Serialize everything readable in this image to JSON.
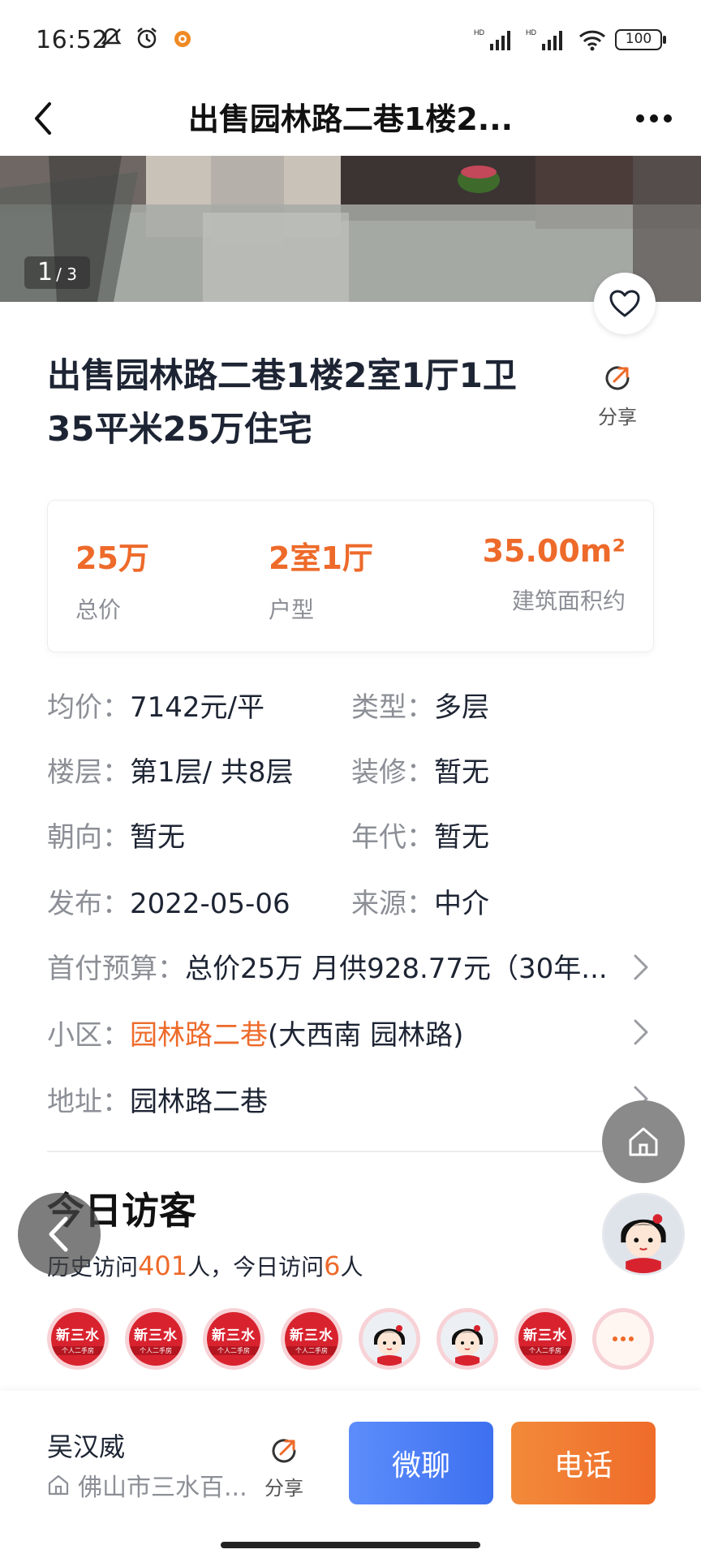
{
  "status_bar": {
    "time": "16:52",
    "battery": "100",
    "icons": [
      "mute-icon",
      "alarm-icon",
      "notification-icon",
      "signal-icon",
      "wifi-icon",
      "battery-icon"
    ]
  },
  "nav": {
    "title": "出售园林路二巷1楼2..."
  },
  "photo": {
    "current": "1",
    "total": " / 3"
  },
  "listing": {
    "title_line1": "出售园林路二巷1楼2室1厅1卫",
    "title_line2": "35平米25万住宅",
    "share_label": "分享"
  },
  "summary": {
    "price_value": "25万",
    "price_label": "总价",
    "layout_value": "2室1厅",
    "layout_label": "户型",
    "area_value": "35.00m²",
    "area_label": "建筑面积约"
  },
  "details": {
    "unit_price_label": "均价：",
    "unit_price_value": "7142元/平",
    "type_label": "类型：",
    "type_value": "多层",
    "floor_label": "楼层：",
    "floor_value": "第1层/ 共8层",
    "decor_label": "装修：",
    "decor_value": "暂无",
    "orient_label": "朝向：",
    "orient_value": "暂无",
    "year_label": "年代：",
    "year_value": "暂无",
    "publish_label": "发布：",
    "publish_value": "2022-05-06",
    "source_label": "来源：",
    "source_value": "中介",
    "budget_label": "首付预算：",
    "budget_value": "总价25万 月供928.77元（30年...",
    "community_label": "小区：",
    "community_name": "园林路二巷",
    "community_area": "(大西南 园林路)",
    "address_label": "地址：",
    "address_value": "园林路二巷"
  },
  "visitors": {
    "title": "今日访客",
    "history_prefix": "历史访问",
    "history_count": "401",
    "today_prefix": "人，今日访问",
    "today_count": "6",
    "suffix": "人",
    "avatar_badge_text": "新三水",
    "avatar_badge_sub": "个人二手房"
  },
  "agent": {
    "name": "吴汉威",
    "store": "佛山市三水百...",
    "share_label": "分享",
    "chat_label": "微聊",
    "call_label": "电话"
  },
  "colors": {
    "accent_orange": "#ee6a2a",
    "chat_blue": "#4a7cf5",
    "text_dark": "#1d2433",
    "text_gray": "#8c8f96"
  }
}
